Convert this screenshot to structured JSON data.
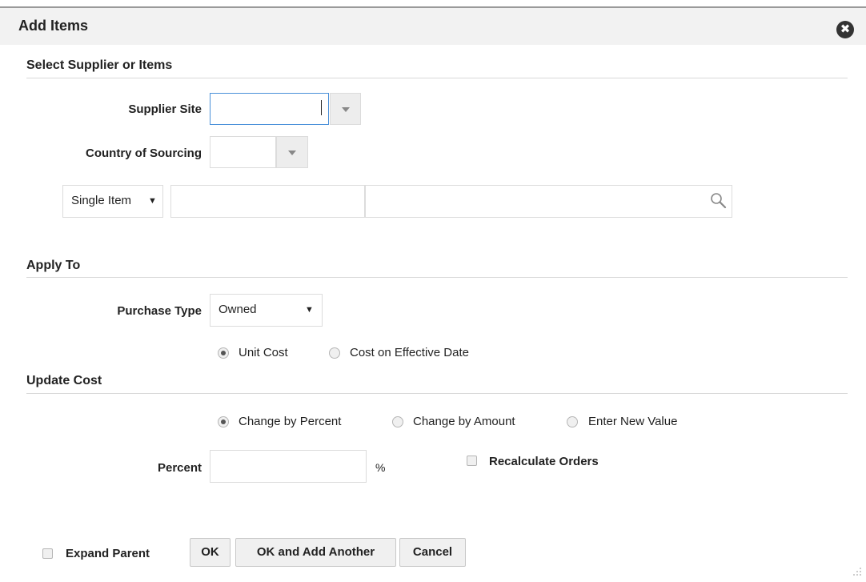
{
  "dialog": {
    "title": "Add Items",
    "close_glyph": "✖"
  },
  "sections": {
    "select": "Select Supplier or Items",
    "apply_to": "Apply To",
    "update_cost": "Update Cost"
  },
  "fields": {
    "supplier_site": {
      "label": "Supplier Site",
      "value": ""
    },
    "country_of_sourcing": {
      "label": "Country of Sourcing",
      "value": ""
    },
    "item_type": {
      "selected": "Single Item",
      "arrow": "▼"
    },
    "item_id": {
      "value": ""
    },
    "item_description": {
      "value": ""
    },
    "purchase_type": {
      "label": "Purchase Type",
      "selected": "Owned",
      "arrow": "▼"
    },
    "percent": {
      "label": "Percent",
      "value": "",
      "unit": "%"
    }
  },
  "apply_to_options": [
    {
      "label": "Unit Cost",
      "selected": true
    },
    {
      "label": "Cost on Effective Date",
      "selected": false
    }
  ],
  "update_cost_options": [
    {
      "label": "Change by Percent",
      "selected": true
    },
    {
      "label": "Change by Amount",
      "selected": false
    },
    {
      "label": "Enter New Value",
      "selected": false
    }
  ],
  "recalculate_orders": {
    "label": "Recalculate Orders",
    "checked": false
  },
  "expand_parent": {
    "label": "Expand Parent",
    "checked": false
  },
  "buttons": {
    "ok": "OK",
    "ok_add_another": "OK and Add Another",
    "cancel": "Cancel"
  },
  "icons": {
    "close": "close-icon",
    "search": "search-icon",
    "dropdown": "chevron-down-icon",
    "resize": "resize-grip-icon"
  },
  "colors": {
    "focus_border": "#4a90d9",
    "title_bar": "#f2f2f2",
    "close_bg": "#333333"
  }
}
